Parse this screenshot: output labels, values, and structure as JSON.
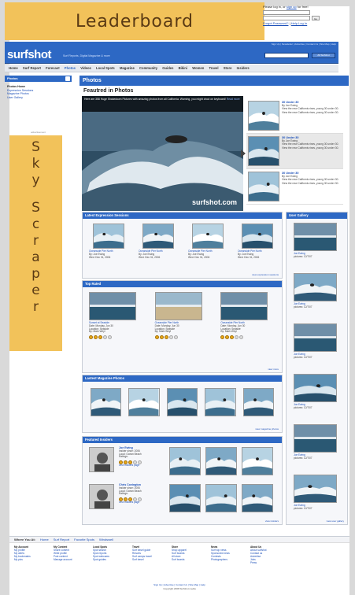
{
  "ads": {
    "leaderboard": "Leaderboard",
    "skyscraper_letters": [
      "S",
      "k",
      "y",
      "",
      "S",
      "c",
      "r",
      "a",
      "p",
      "e",
      "r"
    ],
    "advertisement_label": "advertisement"
  },
  "login": {
    "line1": "Please log in, or",
    "signup": "sign up",
    "line1b": "for free!",
    "forgot": "Forgot Password?",
    "help": "Help Log In",
    "go": "Go"
  },
  "header": {
    "logo": "surfshot",
    "tagline": "Surf Reports, Digital Magazine & more",
    "toplinks": "Sign Up | Newsletter | Advertise | Contact Us | Site Map | Help",
    "search_select": "All Surfshot"
  },
  "nav": [
    "Home",
    "Surf Report",
    "Forecast",
    "Photos",
    "Videos",
    "Local Spots",
    "Magazine",
    "Community",
    "Guides",
    "Bikini",
    "Women",
    "Travel",
    "Store",
    "Insiders"
  ],
  "nav_active": "Photos",
  "left": {
    "header": "Photos",
    "items": [
      "Photos Home",
      "Expression Sessions",
      "Magazine Photos",
      "User Gallery"
    ]
  },
  "main": {
    "header": "Photos",
    "featured_title": "Feautred in Photos",
    "hero_caption": "Here are 358 Huge Shakedown Pictures with amazing photos from all California. Warning, you might drool on keyboard!",
    "hero_more": "Read more",
    "hero_watermark": "surfshot.com",
    "side_items": [
      {
        "title": "30 Under 30",
        "by": "By Joe Ewing",
        "desc": "View the new Californis rises, young 30 under 30. View the new Californis rises, young 30 under 30."
      },
      {
        "title": "30 Under 30",
        "by": "By Joe Ewing",
        "desc": "View the new Californis rises, young 30 under 30. View the new Californis rises, young 30 under 30."
      },
      {
        "title": "30 Under 30",
        "by": "By Joe Ewing",
        "desc": "View the new Californis rises, young 30 under 30. View the new Californis rises, young 30 under 30."
      }
    ],
    "sessions": {
      "header": "Latest Expression Sessions",
      "items": [
        {
          "title": "Oceanside Pier North",
          "by": "By: Joe Ewing",
          "date": "Wed. Dec 31, 2006"
        },
        {
          "title": "Oceanside Pier North",
          "by": "By: Joe Ewing",
          "date": "Wed. Dec 31, 2006"
        },
        {
          "title": "Oceanside Pier North",
          "by": "By: Joe Ewing",
          "date": "Wed. Dec 31, 2006"
        },
        {
          "title": "Oceanside Pier North",
          "by": "By: Joe Ewing",
          "date": "Wed. Dec 31, 2006"
        }
      ],
      "more": "view expression sessions"
    },
    "toprated": {
      "header": "Top Rated",
      "items": [
        {
          "title": "Sunset at Seaside",
          "date": "Date: Monday, Jun 30",
          "loc": "Location: Seaside",
          "by": "By: Mark Weyl",
          "rating": 3
        },
        {
          "title": "Oceanside Pier North",
          "date": "Date: Monday, Jun 30",
          "loc": "Location: Seaside",
          "by": "By: Mark Weyl",
          "rating": 3
        },
        {
          "title": "Oceanside Pier North",
          "date": "Date: Monday, Jun 30",
          "loc": "Location: Seaside",
          "by": "By: Mark Weyl",
          "rating": 3
        }
      ],
      "more": "view more"
    },
    "magazine": {
      "header": "Lastest Magazine Photos",
      "more": "view magazine photos"
    },
    "insiders": {
      "header": "Featured Insiders",
      "items": [
        {
          "name": "Joe Ewing",
          "since": "Insider since: 2006",
          "local": "Local: Ocean Beach",
          "ratings": "Ratings:",
          "link": "view insiders page"
        },
        {
          "name": "Chris Covington",
          "since": "Insider since: 2006",
          "local": "Local: Ocean Beach",
          "ratings": "Ratings:",
          "link": "view insiders page"
        }
      ],
      "more": "view insiders"
    },
    "gallery": {
      "header": "User Gallery",
      "items": [
        {
          "name": "Joe Ewing",
          "date": "pictures: 12/7/07"
        },
        {
          "name": "Joe Ewing",
          "date": "pictures: 12/7/07"
        },
        {
          "name": "Joe Ewing",
          "date": "pictures: 12/7/07"
        },
        {
          "name": "Joe Ewing",
          "date": "pictures: 12/7/07"
        },
        {
          "name": "Joe Ewing",
          "date": "pictures: 12/7/07"
        },
        {
          "name": "Joe Ewing",
          "date": "pictures: 12/7/07"
        }
      ],
      "more": "view user gallery"
    }
  },
  "footer": {
    "where": "Where You At:",
    "crumbs": [
      "Home",
      "Surf Report",
      "Favorite Spots",
      "Windswell"
    ],
    "cols": [
      {
        "h": "My Account",
        "l": [
          "My profile",
          "My alerts",
          "My bookmarks",
          "My pics"
        ]
      },
      {
        "h": "My Content",
        "l": [
          "Share content",
          "Write profile",
          "Post content",
          "Manage account"
        ]
      },
      {
        "h": "Local Spots",
        "l": [
          "Spot search",
          "Spot reports",
          "Spot webcams",
          "Spot guides"
        ]
      },
      {
        "h": "Travel",
        "l": [
          "Surf travel guide",
          "Resorts",
          "Surf camps travel",
          "Surf travel"
        ]
      },
      {
        "h": "Store",
        "l": [
          "Shop apparel",
          "Surf boards",
          "All store",
          "Surf boards"
        ]
      },
      {
        "h": "News",
        "l": [
          "Surf top news",
          "Sponsored news",
          "Contests",
          "Photographers"
        ]
      },
      {
        "h": "About Us",
        "l": [
          "About surfshot",
          "Contact us",
          "Advertise",
          "Jobs",
          "Press"
        ]
      }
    ],
    "bottom_links": "Sign Up | Advertise | Contact Us | Site Map | Help",
    "copyright": "Copyright 2008 Surfshot media"
  }
}
